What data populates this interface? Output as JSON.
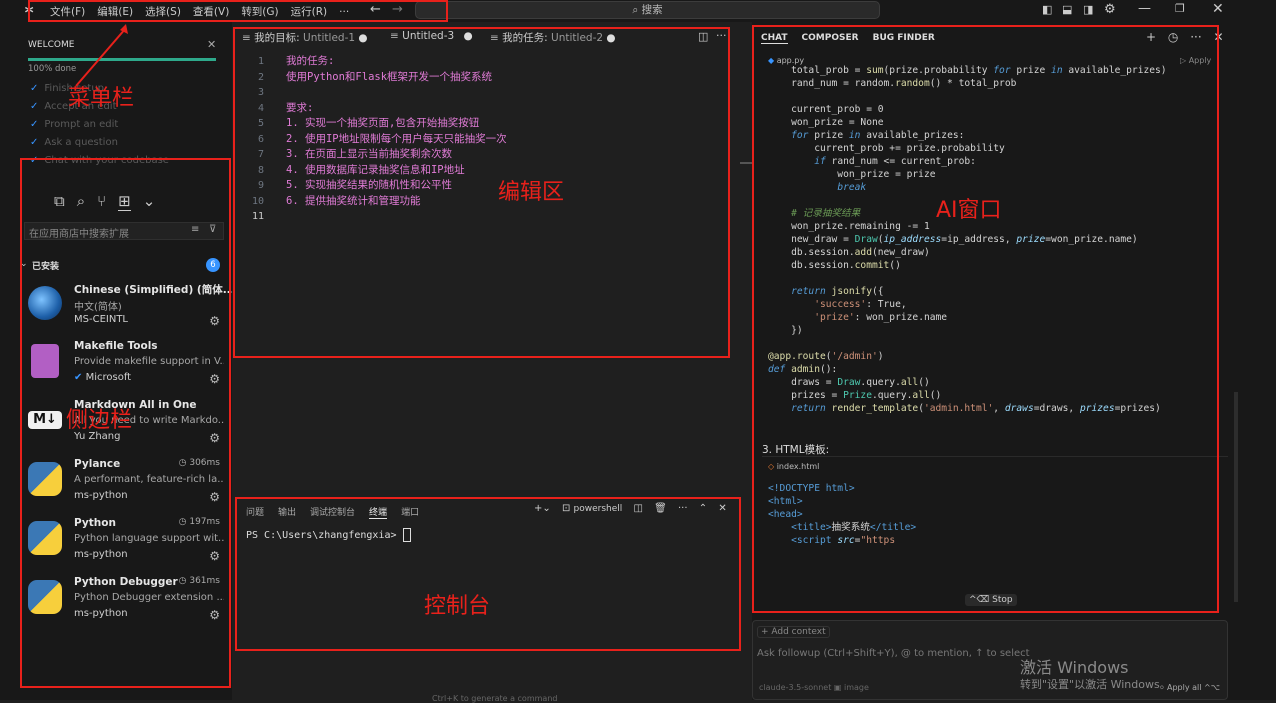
{
  "titlebar": {
    "menu": [
      "文件(F)",
      "编辑(E)",
      "选择(S)",
      "查看(V)",
      "转到(G)",
      "运行(R)",
      "···"
    ],
    "search": "搜索"
  },
  "welcome": {
    "title": "WELCOME",
    "progress_text": "100% done",
    "progress": 1.0,
    "items": [
      "Finish setup",
      "Accept an edit",
      "Prompt an edit",
      "Ask a question",
      "Chat with your codebase"
    ]
  },
  "extensions": {
    "search_placeholder": "在应用商店中搜索扩展",
    "installed_label": "已安装",
    "installed_count": "6",
    "items": [
      {
        "name": "Chinese (Simplified) (简体...",
        "desc": "中文(简体)",
        "publisher": "MS-CEINTL",
        "time": ""
      },
      {
        "name": "Makefile Tools",
        "desc": "Provide makefile support in V...",
        "publisher": "Microsoft",
        "time": ""
      },
      {
        "name": "Markdown All in One",
        "desc": "All you need to write Markdo...",
        "publisher": "Yu Zhang",
        "time": ""
      },
      {
        "name": "Pylance",
        "desc": "A performant, feature-rich la...",
        "publisher": "ms-python",
        "time": "306ms"
      },
      {
        "name": "Python",
        "desc": "Python language support wit...",
        "publisher": "ms-python",
        "time": "197ms"
      },
      {
        "name": "Python Debugger",
        "desc": "Python Debugger extension ...",
        "publisher": "ms-python",
        "time": "361ms"
      }
    ]
  },
  "editor": {
    "tabs": [
      {
        "title": "我的目标:",
        "file": "Untitled-1"
      },
      {
        "title": "Untitled-3",
        "file": ""
      },
      {
        "title": "我的任务:",
        "file": "Untitled-2"
      }
    ],
    "lines": [
      "我的任务:",
      "使用Python和Flask框架开发一个抽奖系统",
      "",
      "要求:",
      "1. 实现一个抽奖页面,包含开始抽奖按钮",
      "2. 使用IP地址限制每个用户每天只能抽奖一次",
      "3. 在页面上显示当前抽奖剩余次数",
      "4. 使用数据库记录抽奖信息和IP地址",
      "5. 实现抽奖结果的随机性和公平性",
      "6. 提供抽奖统计和管理功能",
      ""
    ],
    "hint": "Ctrl+K to generate a command"
  },
  "terminal": {
    "tabs": [
      "问题",
      "输出",
      "调试控制台",
      "终端",
      "端口"
    ],
    "active_tab": "终端",
    "shell": "powershell",
    "prompt": "PS C:\\Users\\zhangfengxia> "
  },
  "chat": {
    "tabs": [
      "CHAT",
      "COMPOSER",
      "BUG FINDER"
    ],
    "file1": "app.py",
    "apply": "Apply",
    "section": "3. HTML模板:",
    "file2": "index.html",
    "stop": "^⌫ Stop",
    "add_context": "+ Add context",
    "input_placeholder": "Ask followup (Ctrl+Shift+Y), @ to mention, ↑ to select",
    "model": "claude-3.5-sonnet",
    "image": "image",
    "apply_all": "Apply all ^⌥"
  },
  "watermark": {
    "title": "激活 Windows",
    "sub": "转到\"设置\"以激活 Windows。"
  },
  "annotations": {
    "menubar": "菜单栏",
    "editor": "编辑区",
    "ai": "AI窗口",
    "sidebar": "侧边栏",
    "console": "控制台"
  }
}
